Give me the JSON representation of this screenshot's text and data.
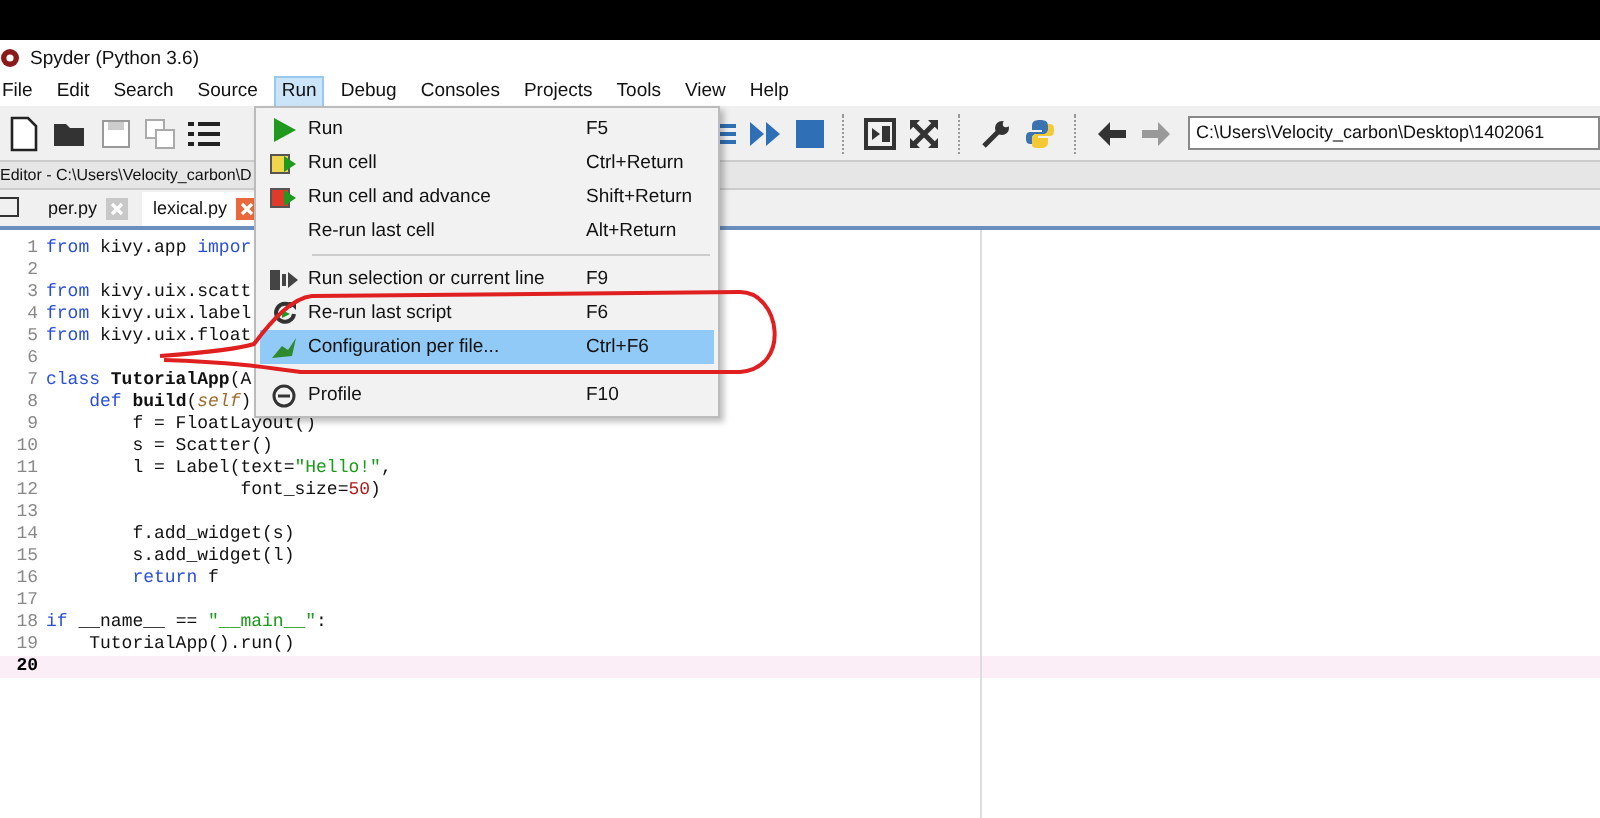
{
  "window": {
    "title": "Spyder (Python 3.6)"
  },
  "menu_bar": [
    {
      "label": "File",
      "selected": false
    },
    {
      "label": "Edit",
      "selected": false
    },
    {
      "label": "Search",
      "selected": false
    },
    {
      "label": "Source",
      "selected": false
    },
    {
      "label": "Run",
      "selected": true
    },
    {
      "label": "Debug",
      "selected": false
    },
    {
      "label": "Consoles",
      "selected": false
    },
    {
      "label": "Projects",
      "selected": false
    },
    {
      "label": "Tools",
      "selected": false
    },
    {
      "label": "View",
      "selected": false
    },
    {
      "label": "Help",
      "selected": false
    }
  ],
  "toolbar": {
    "working_directory": "C:\\Users\\Velocity_carbon\\Desktop\\1402061"
  },
  "editor": {
    "path_label": "Editor - C:\\Users\\Velocity_carbon\\D",
    "tabs": [
      {
        "label": "per.py",
        "selected": false
      },
      {
        "label": "lexical.py",
        "selected": true
      }
    ],
    "lines": [
      {
        "number": "1",
        "current": false,
        "segments": [
          {
            "text": "from",
            "kind": "keyword"
          },
          {
            "text": " kivy.app ",
            "kind": "plain"
          },
          {
            "text": "impor",
            "kind": "keyword"
          }
        ]
      },
      {
        "number": "2",
        "current": false
      },
      {
        "number": "3",
        "current": false,
        "segments": [
          {
            "text": "from",
            "kind": "keyword"
          },
          {
            "text": " kivy.uix.scatt",
            "kind": "plain"
          }
        ]
      },
      {
        "number": "4",
        "current": false,
        "segments": [
          {
            "text": "from",
            "kind": "keyword"
          },
          {
            "text": " kivy.uix.label",
            "kind": "plain"
          }
        ]
      },
      {
        "number": "5",
        "current": false,
        "segments": [
          {
            "text": "from",
            "kind": "keyword"
          },
          {
            "text": " kivy.uix.float",
            "kind": "plain"
          }
        ]
      },
      {
        "number": "6",
        "current": false
      },
      {
        "number": "7",
        "current": false,
        "segments": [
          {
            "text": "class ",
            "kind": "keyword"
          },
          {
            "text": "TutorialApp",
            "kind": "defname"
          },
          {
            "text": "(A",
            "kind": "plain"
          }
        ]
      },
      {
        "number": "8",
        "current": false,
        "segments": [
          {
            "text": "    def ",
            "kind": "keyword"
          },
          {
            "text": "build",
            "kind": "defname"
          },
          {
            "text": "(",
            "kind": "plain"
          },
          {
            "text": "self",
            "kind": "self"
          },
          {
            "text": ")",
            "kind": "plain"
          }
        ]
      },
      {
        "number": "9",
        "current": false,
        "segments": [
          {
            "text": "        f = FloatLayout()",
            "kind": "plain"
          }
        ]
      },
      {
        "number": "10",
        "current": false,
        "segments": [
          {
            "text": "        s = Scatter()",
            "kind": "plain"
          }
        ]
      },
      {
        "number": "11",
        "current": false,
        "segments": [
          {
            "text": "        l = Label(text=",
            "kind": "plain"
          },
          {
            "text": "\"Hello!\"",
            "kind": "string"
          },
          {
            "text": ",",
            "kind": "plain"
          }
        ]
      },
      {
        "number": "12",
        "current": false,
        "segments": [
          {
            "text": "                  font_size=",
            "kind": "plain"
          },
          {
            "text": "50",
            "kind": "number"
          },
          {
            "text": ")",
            "kind": "plain"
          }
        ]
      },
      {
        "number": "13",
        "current": false
      },
      {
        "number": "14",
        "current": false,
        "segments": [
          {
            "text": "        f.add_widget(s)",
            "kind": "plain"
          }
        ]
      },
      {
        "number": "15",
        "current": false,
        "segments": [
          {
            "text": "        s.add_widget(l)",
            "kind": "plain"
          }
        ]
      },
      {
        "number": "16",
        "current": false,
        "segments": [
          {
            "text": "        return",
            "kind": "keyword"
          },
          {
            "text": " f",
            "kind": "plain"
          }
        ]
      },
      {
        "number": "17",
        "current": false
      },
      {
        "number": "18",
        "current": false,
        "segments": [
          {
            "text": "if",
            "kind": "keyword"
          },
          {
            "text": " __name__ == ",
            "kind": "plain"
          },
          {
            "text": "\"__main__\"",
            "kind": "string"
          },
          {
            "text": ":",
            "kind": "plain"
          }
        ]
      },
      {
        "number": "19",
        "current": false,
        "segments": [
          {
            "text": "    TutorialApp().run()",
            "kind": "plain"
          }
        ]
      },
      {
        "number": "20",
        "current": true
      }
    ]
  },
  "run_menu": [
    {
      "kind": "item",
      "label": "Run",
      "shortcut": "F5",
      "selected": false
    },
    {
      "kind": "item",
      "label": "Run cell",
      "shortcut": "Ctrl+Return",
      "selected": false
    },
    {
      "kind": "item",
      "label": "Run cell and advance",
      "shortcut": "Shift+Return",
      "selected": false
    },
    {
      "kind": "item",
      "label": "Re-run last cell",
      "shortcut": "Alt+Return",
      "selected": false
    },
    {
      "kind": "separator"
    },
    {
      "kind": "item",
      "label": "Run selection or current line",
      "shortcut": "F9",
      "selected": false
    },
    {
      "kind": "item",
      "label": "Re-run last script",
      "shortcut": "F6",
      "selected": false
    },
    {
      "kind": "item",
      "label": "Configuration per file...",
      "shortcut": "Ctrl+F6",
      "selected": true
    },
    {
      "kind": "separator"
    },
    {
      "kind": "item",
      "label": "Profile",
      "shortcut": "F10",
      "selected": false
    }
  ]
}
